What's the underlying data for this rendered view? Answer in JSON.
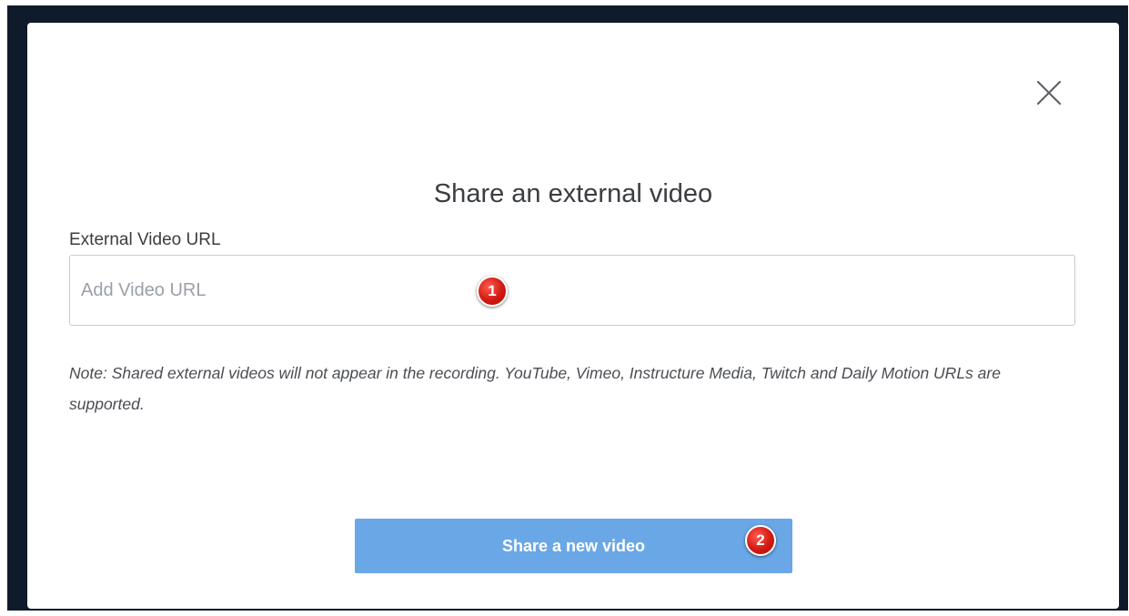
{
  "modal": {
    "title": "Share an external video",
    "close_icon": "close-icon",
    "url_field": {
      "label": "External Video URL",
      "value": "",
      "placeholder": "Add Video URL"
    },
    "note": "Note: Shared external videos will not appear in the recording. YouTube, Vimeo, Instructure Media, Twitch and Daily Motion URLs are supported.",
    "submit_label": "Share a new video"
  },
  "annotations": {
    "marker_1": "1",
    "marker_2": "2"
  },
  "colors": {
    "backdrop": "#0f1b2b",
    "button": "#6aa7e6",
    "marker": "#d11a12"
  }
}
